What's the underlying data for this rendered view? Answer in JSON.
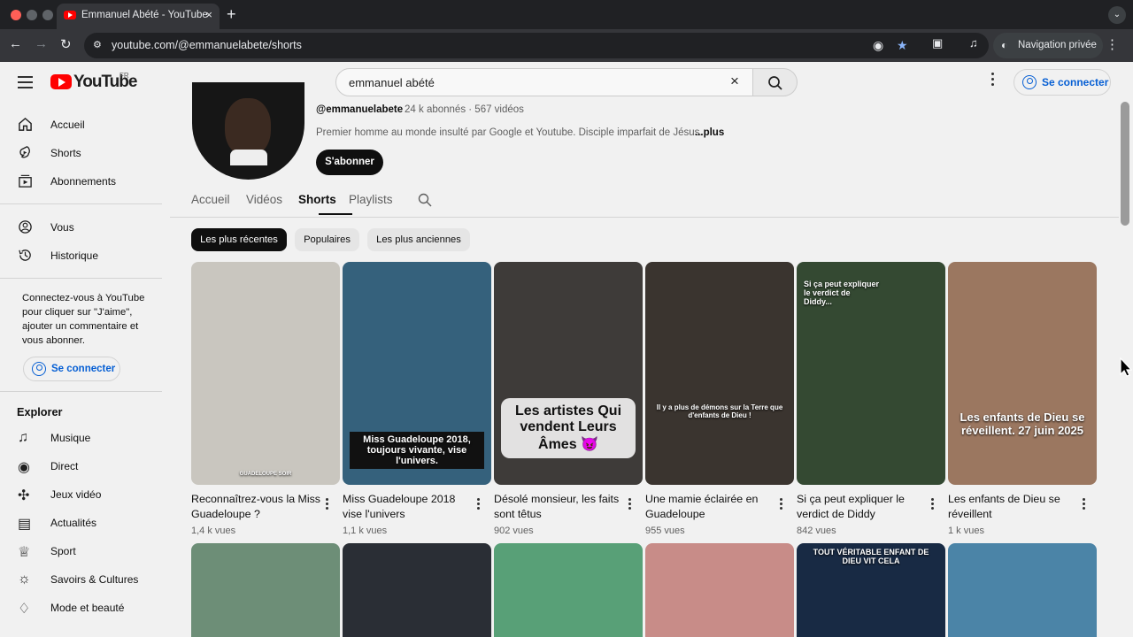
{
  "browser": {
    "tab_title": "Emmanuel Abété - YouTube",
    "url": "youtube.com/@emmanuelabete/shorts",
    "private_label": "Navigation privée"
  },
  "masthead": {
    "logo_text": "YouTube",
    "country": "FR",
    "search_value": "emmanuel abété",
    "signin_label": "Se connecter"
  },
  "sidebar": {
    "main_items": [
      {
        "label": "Accueil",
        "icon": "home-icon"
      },
      {
        "label": "Shorts",
        "icon": "shorts-icon"
      },
      {
        "label": "Abonnements",
        "icon": "subscriptions-icon"
      }
    ],
    "you_items": [
      {
        "label": "Vous",
        "icon": "you-icon"
      },
      {
        "label": "Historique",
        "icon": "history-icon"
      }
    ],
    "promo_text": "Connectez-vous à YouTube pour cliquer sur \"J'aime\", ajouter un commentaire et vous abonner.",
    "signin_label": "Se connecter",
    "explore_title": "Explorer",
    "explore_items": [
      {
        "label": "Musique",
        "icon": "music-icon"
      },
      {
        "label": "Direct",
        "icon": "live-icon"
      },
      {
        "label": "Jeux vidéo",
        "icon": "gaming-icon"
      },
      {
        "label": "Actualités",
        "icon": "news-icon"
      },
      {
        "label": "Sport",
        "icon": "trophy-icon"
      },
      {
        "label": "Savoirs & Cultures",
        "icon": "learning-icon"
      },
      {
        "label": "Mode et beauté",
        "icon": "fashion-icon"
      }
    ]
  },
  "channel": {
    "handle": "@emmanuelabete",
    "stats": "· 24 k abonnés · 567 vidéos",
    "bio": "Premier homme au monde insulté par Google et Youtube. Disciple imparfait de Jésus.",
    "bio_more": "...plus",
    "subscribe_label": "S'abonner",
    "tabs": [
      "Accueil",
      "Vidéos",
      "Shorts",
      "Playlists"
    ],
    "active_tab": "Shorts",
    "chips": [
      "Les plus récentes",
      "Populaires",
      "Les plus anciennes"
    ]
  },
  "shorts": [
    {
      "title": "Reconnaîtrez-vous la Miss Guadeloupe ?",
      "views": "1,4 k vues",
      "caption": "GUADELOUPE SOIR",
      "color": "#c9c6bf"
    },
    {
      "title": "Miss Guadeloupe 2018 vise l'univers",
      "views": "1,1 k vues",
      "caption": "Miss Guadeloupe 2018, toujours vivante, vise l'univers.",
      "color": "#35617c"
    },
    {
      "title": "Désolé monsieur, les faits sont têtus",
      "views": "902 vues",
      "caption": "Les artistes Qui vendent Leurs Âmes 😈",
      "color": "#3e3b39"
    },
    {
      "title": "Une mamie éclairée en Guadeloupe",
      "views": "955 vues",
      "caption": "Il y a plus de démons sur la Terre que d'enfants de Dieu !",
      "color": "#3a342f"
    },
    {
      "title": "Si ça peut expliquer le verdict de Diddy",
      "views": "842 vues",
      "caption": "Si ça peut expliquer le verdict de Diddy...",
      "color": "#344932"
    },
    {
      "title": "Les enfants de Dieu se réveillent",
      "views": "1 k vues",
      "caption": "Les enfants de Dieu se réveillent. 27 juin 2025",
      "color": "#9b7760"
    }
  ],
  "second_row": [
    {
      "color": "#6d8e77"
    },
    {
      "color": "#2a2e35"
    },
    {
      "color": "#58a077"
    },
    {
      "color": "#c88c88"
    },
    {
      "color": "#182a44",
      "caption": "TOUT VÉRITABLE ENFANT DE DIEU VIT CELA"
    },
    {
      "color": "#4b84a7"
    }
  ]
}
